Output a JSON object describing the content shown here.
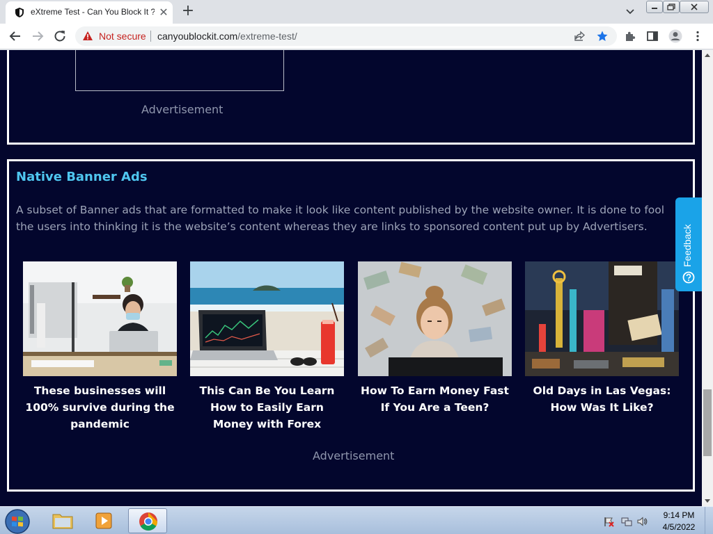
{
  "browser": {
    "tab_title": "eXtreme Test - Can You Block It ?",
    "tab_close_glyph": "✕",
    "new_tab_glyph": "+",
    "security_label": "Not secure",
    "url_host": "canyoublockit.com",
    "url_path": "/extreme-test/"
  },
  "page": {
    "top_ad_label": "Advertisement",
    "native": {
      "title": "Native Banner Ads",
      "description": "A subset of Banner ads that are formatted to make it look like content published by the website owner. It is done to fool the users into thinking it is the website’s content whereas they are links to sponsored content put up by Advertisers.",
      "cards": [
        {
          "title": "These businesses will 100% survive during the pandemic",
          "image": "office-woman-mask-laptop"
        },
        {
          "title": "This Can Be You Learn How to Easily Earn Money with Forex",
          "image": "laptop-on-beach"
        },
        {
          "title": "How To Earn Money Fast If You Are a Teen?",
          "image": "girl-with-flying-money"
        },
        {
          "title": "Old Days in Las Vegas: How Was It Like?",
          "image": "las-vegas-neon-street"
        }
      ],
      "ad_label": "Advertisement"
    },
    "feedback_label": "Feedback"
  },
  "taskbar": {
    "time": "9:14 PM",
    "date": "4/5/2022"
  },
  "colors": {
    "page_background": "#03062d",
    "heading_accent": "#4fc6ef",
    "feedback_tab": "#1aa3e8",
    "not_secure": "#c5221f",
    "bookmark_star": "#1a73e8"
  }
}
